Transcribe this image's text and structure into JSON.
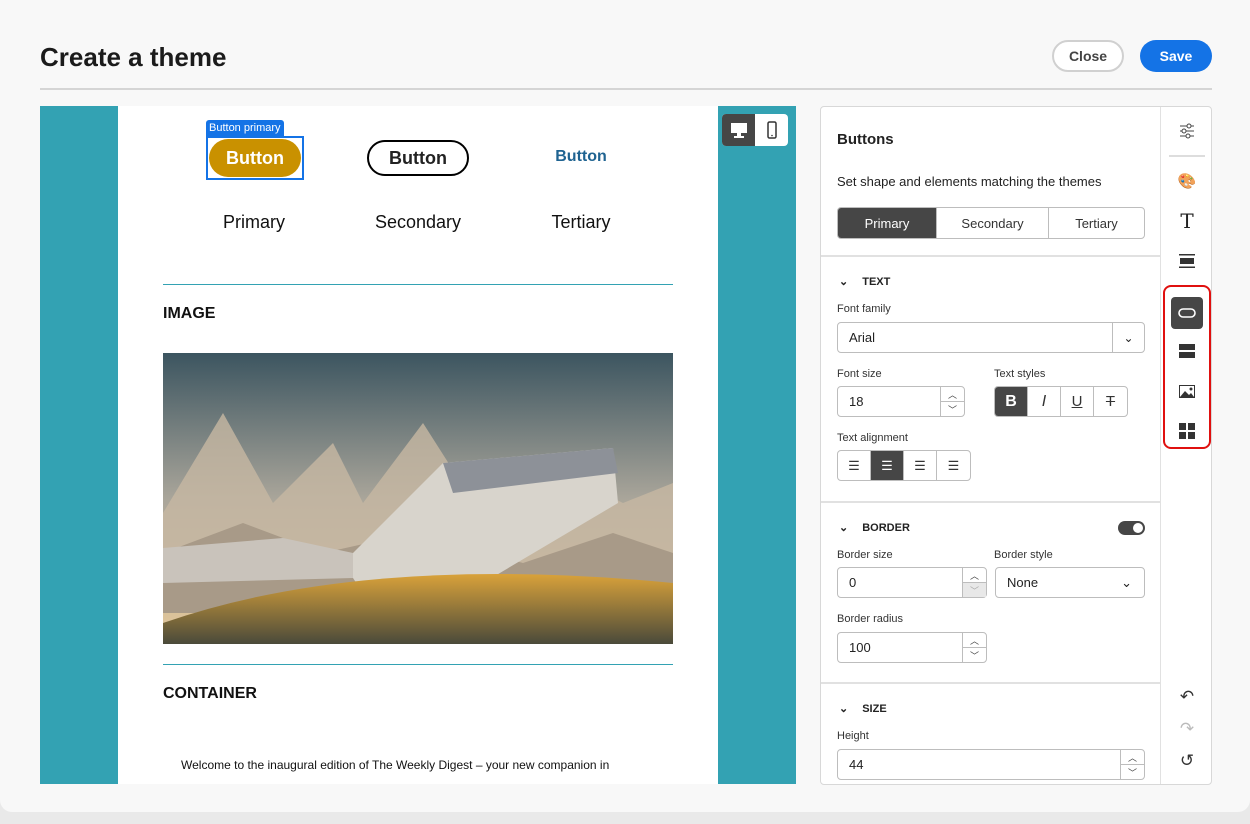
{
  "header": {
    "title": "Create a theme",
    "close_label": "Close",
    "save_label": "Save"
  },
  "preview": {
    "selection_tag": "Button primary",
    "buttons": [
      {
        "label": "Button",
        "caption": "Primary"
      },
      {
        "label": "Button",
        "caption": "Secondary"
      },
      {
        "label": "Button",
        "caption": "Tertiary"
      }
    ],
    "image_heading": "IMAGE",
    "container_heading": "CONTAINER",
    "body_text": "Welcome to the inaugural edition of The Weekly Digest – your new companion in",
    "device_toggle": {
      "options": [
        "desktop-icon",
        "mobile-icon"
      ],
      "selected": "desktop-icon"
    },
    "colors": {
      "canvas": "#33a2b3",
      "primary_button": "#c99100",
      "tertiary_text": "#1f6391",
      "selection": "#1473e6"
    }
  },
  "panel": {
    "title": "Buttons",
    "description": "Set shape and elements matching the themes",
    "tabs": [
      "Primary",
      "Secondary",
      "Tertiary"
    ],
    "selected_tab": "Primary",
    "text": {
      "heading": "TEXT",
      "font_family_label": "Font family",
      "font_family": "Arial",
      "font_size_label": "Font size",
      "font_size": "18",
      "text_styles_label": "Text styles",
      "styles": [
        "B",
        "I",
        "U",
        "T"
      ],
      "bold_active": true,
      "alignment_label": "Text alignment",
      "alignment": "center"
    },
    "border": {
      "heading": "BORDER",
      "enabled": true,
      "size_label": "Border size",
      "size": "0",
      "style_label": "Border style",
      "style": "None",
      "radius_label": "Border radius",
      "radius": "100"
    },
    "size": {
      "heading": "SIZE",
      "height_label": "Height",
      "height": "44"
    }
  },
  "rail": {
    "items": [
      "settings-sliders-icon",
      "palette-icon",
      "text-icon",
      "divider-block-icon",
      "button-icon",
      "structure-icon",
      "image-icon",
      "grid-icon"
    ],
    "active": "button-icon",
    "actions": [
      "undo-icon",
      "redo-icon",
      "reset-icon"
    ]
  }
}
